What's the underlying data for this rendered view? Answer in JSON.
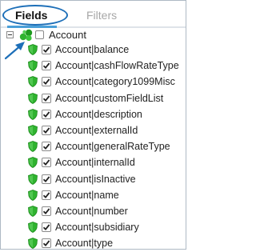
{
  "tabs": {
    "fields_label": "Fields",
    "filters_label": "Filters",
    "active": "Fields"
  },
  "tree": {
    "root_label": "Account",
    "root_checked": false,
    "expanded": true,
    "icons": {
      "root": "green-dot-cluster-icon",
      "field": "green-shield-icon"
    },
    "items": [
      {
        "label": "Account|balance",
        "checked": true
      },
      {
        "label": "Account|cashFlowRateType",
        "checked": true
      },
      {
        "label": "Account|category1099Misc",
        "checked": true
      },
      {
        "label": "Account|customFieldList",
        "checked": true
      },
      {
        "label": "Account|description",
        "checked": true
      },
      {
        "label": "Account|externalId",
        "checked": true
      },
      {
        "label": "Account|generalRateType",
        "checked": true
      },
      {
        "label": "Account|internalId",
        "checked": true
      },
      {
        "label": "Account|isInactive",
        "checked": true
      },
      {
        "label": "Account|name",
        "checked": true
      },
      {
        "label": "Account|number",
        "checked": true
      },
      {
        "label": "Account|subsidiary",
        "checked": true
      },
      {
        "label": "Account|type",
        "checked": true
      }
    ]
  },
  "colors": {
    "accent": "#4a9fd8",
    "annotation": "#1d6fb8",
    "icon_green": "#2fb32f",
    "border": "#aeb9c4"
  }
}
